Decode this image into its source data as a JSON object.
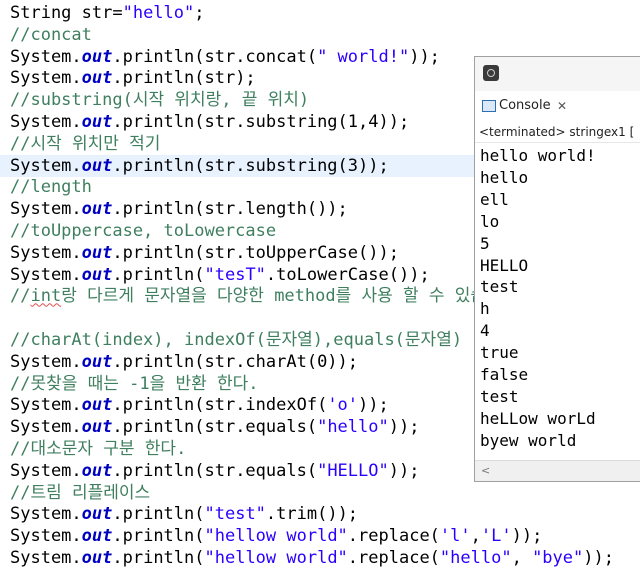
{
  "editor": {
    "lines": [
      {
        "parts": [
          {
            "c": "",
            "t": "String str="
          },
          {
            "c": "str",
            "t": "\"hello\""
          },
          {
            "c": "",
            "t": ";"
          }
        ]
      },
      {
        "parts": [
          {
            "c": "cm",
            "t": "//concat"
          }
        ]
      },
      {
        "parts": [
          {
            "c": "",
            "t": "System."
          },
          {
            "c": "fld",
            "t": "out"
          },
          {
            "c": "",
            "t": ".println(str.concat("
          },
          {
            "c": "str",
            "t": "\" world!\""
          },
          {
            "c": "",
            "t": "));"
          }
        ]
      },
      {
        "parts": [
          {
            "c": "",
            "t": "System."
          },
          {
            "c": "fld",
            "t": "out"
          },
          {
            "c": "",
            "t": ".println(str);"
          }
        ]
      },
      {
        "parts": [
          {
            "c": "cm",
            "t": "//substring("
          },
          {
            "c": "cm kr",
            "t": "시작 위치랑, 끝 위치"
          },
          {
            "c": "cm",
            "t": ")"
          }
        ]
      },
      {
        "parts": [
          {
            "c": "",
            "t": "System."
          },
          {
            "c": "fld",
            "t": "out"
          },
          {
            "c": "",
            "t": ".println(str.substring(1,4));"
          }
        ]
      },
      {
        "parts": [
          {
            "c": "cm",
            "t": "//"
          },
          {
            "c": "cm kr",
            "t": "시작 위치만 적기"
          }
        ]
      },
      {
        "hl": true,
        "parts": [
          {
            "c": "",
            "t": "System."
          },
          {
            "c": "fld",
            "t": "out"
          },
          {
            "c": "",
            "t": ".println(str.substring(3));"
          }
        ]
      },
      {
        "parts": [
          {
            "c": "cm",
            "t": "//length"
          }
        ]
      },
      {
        "parts": [
          {
            "c": "",
            "t": "System."
          },
          {
            "c": "fld",
            "t": "out"
          },
          {
            "c": "",
            "t": ".println(str.length());"
          }
        ]
      },
      {
        "parts": [
          {
            "c": "cm",
            "t": "//toUppercase, toLowercase"
          }
        ]
      },
      {
        "parts": [
          {
            "c": "",
            "t": "System."
          },
          {
            "c": "fld",
            "t": "out"
          },
          {
            "c": "",
            "t": ".println(str.toUpperCase());"
          }
        ]
      },
      {
        "parts": [
          {
            "c": "",
            "t": "System."
          },
          {
            "c": "fld",
            "t": "out"
          },
          {
            "c": "",
            "t": ".println("
          },
          {
            "c": "str",
            "t": "\"tesT\""
          },
          {
            "c": "",
            "t": ".toLowerCase());"
          }
        ]
      },
      {
        "parts": [
          {
            "c": "cm",
            "t": "//"
          },
          {
            "c": "cm squig",
            "t": "int"
          },
          {
            "c": "cm kr",
            "t": "랑 다르게 문자열을 다양한 "
          },
          {
            "c": "cm",
            "t": "method"
          },
          {
            "c": "cm kr",
            "t": "를 사용 할 수 있습니다."
          }
        ]
      },
      {
        "parts": [
          {
            "c": "",
            "t": " "
          }
        ]
      },
      {
        "parts": [
          {
            "c": "cm",
            "t": "//charAt(index), indexOf("
          },
          {
            "c": "cm kr",
            "t": "문자열"
          },
          {
            "c": "cm",
            "t": "),equals("
          },
          {
            "c": "cm kr",
            "t": "문자열"
          },
          {
            "c": "cm",
            "t": ")"
          }
        ]
      },
      {
        "parts": [
          {
            "c": "",
            "t": "System."
          },
          {
            "c": "fld",
            "t": "out"
          },
          {
            "c": "",
            "t": ".println(str.charAt(0));"
          }
        ]
      },
      {
        "parts": [
          {
            "c": "cm",
            "t": "//"
          },
          {
            "c": "cm kr",
            "t": "못찾을 때는 "
          },
          {
            "c": "cm",
            "t": "-1"
          },
          {
            "c": "cm kr",
            "t": "을 반환 한다."
          }
        ]
      },
      {
        "parts": [
          {
            "c": "",
            "t": "System."
          },
          {
            "c": "fld",
            "t": "out"
          },
          {
            "c": "",
            "t": ".println(str.indexOf("
          },
          {
            "c": "str",
            "t": "'o'"
          },
          {
            "c": "",
            "t": "));"
          }
        ]
      },
      {
        "parts": [
          {
            "c": "",
            "t": "System."
          },
          {
            "c": "fld",
            "t": "out"
          },
          {
            "c": "",
            "t": ".println(str.equals("
          },
          {
            "c": "str",
            "t": "\"hello\""
          },
          {
            "c": "",
            "t": "));"
          }
        ]
      },
      {
        "parts": [
          {
            "c": "cm",
            "t": "//"
          },
          {
            "c": "cm kr",
            "t": "대소문자 구분 한다."
          }
        ]
      },
      {
        "parts": [
          {
            "c": "",
            "t": "System."
          },
          {
            "c": "fld",
            "t": "out"
          },
          {
            "c": "",
            "t": ".println(str.equals("
          },
          {
            "c": "str",
            "t": "\"HELLO\""
          },
          {
            "c": "",
            "t": "));"
          }
        ]
      },
      {
        "parts": [
          {
            "c": "cm",
            "t": "//"
          },
          {
            "c": "cm kr",
            "t": "트림 리플레이스"
          }
        ]
      },
      {
        "parts": [
          {
            "c": "",
            "t": "System."
          },
          {
            "c": "fld",
            "t": "out"
          },
          {
            "c": "",
            "t": ".println("
          },
          {
            "c": "str",
            "t": "\"test\""
          },
          {
            "c": "",
            "t": ".trim());"
          }
        ]
      },
      {
        "parts": [
          {
            "c": "",
            "t": "System."
          },
          {
            "c": "fld",
            "t": "out"
          },
          {
            "c": "",
            "t": ".println("
          },
          {
            "c": "str",
            "t": "\"hellow world\""
          },
          {
            "c": "",
            "t": ".replace("
          },
          {
            "c": "str",
            "t": "'l'"
          },
          {
            "c": "",
            "t": ","
          },
          {
            "c": "str",
            "t": "'L'"
          },
          {
            "c": "",
            "t": "));"
          }
        ]
      },
      {
        "parts": [
          {
            "c": "",
            "t": "System."
          },
          {
            "c": "fld",
            "t": "out"
          },
          {
            "c": "",
            "t": ".println("
          },
          {
            "c": "str",
            "t": "\"hellow world\""
          },
          {
            "c": "",
            "t": ".replace("
          },
          {
            "c": "str",
            "t": "\"hello\""
          },
          {
            "c": "",
            "t": ", "
          },
          {
            "c": "str",
            "t": "\"bye\""
          },
          {
            "c": "",
            "t": "));"
          }
        ]
      }
    ]
  },
  "console": {
    "icon": "minimize-maximize-icon",
    "tab_label": "Console",
    "tab_close": "✕",
    "status": "<terminated> stringex1 [",
    "output": [
      "hello world!",
      "hello",
      "ell",
      "lo",
      "5",
      "HELLO",
      "test",
      "h",
      "4",
      "true",
      "false",
      "test",
      "heLLow worLd",
      "byew world"
    ],
    "scroll_left": "<"
  },
  "colors": {
    "keyword": "#7f0055",
    "field": "#0000c0",
    "string": "#2a00ff",
    "comment": "#3f7f5f",
    "current_line": "#e8f2fe"
  }
}
